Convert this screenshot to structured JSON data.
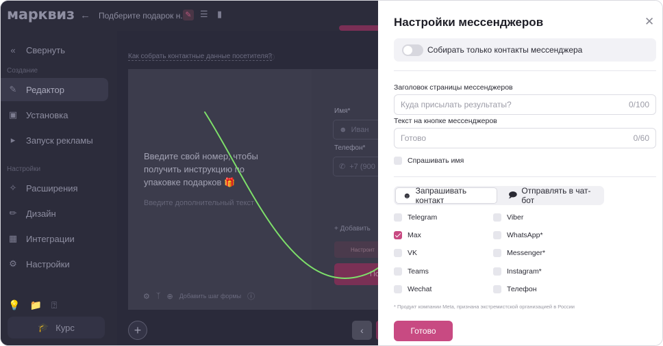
{
  "app": {
    "logo": "марквиз",
    "page_name": "Подберите подарок н...",
    "sidebar": {
      "collapse": "Свернуть",
      "section_create": "Создание",
      "section_settings": "Настройки",
      "items": [
        {
          "label": "Редактор",
          "icon": "pencil-icon",
          "active": true
        },
        {
          "label": "Установка",
          "icon": "install-icon"
        },
        {
          "label": "Запуск рекламы",
          "icon": "megaphone-icon"
        },
        {
          "label": "Расширения",
          "icon": "puzzle-icon"
        },
        {
          "label": "Дизайн",
          "icon": "brush-icon"
        },
        {
          "label": "Интеграции",
          "icon": "integrations-icon"
        },
        {
          "label": "Настройки",
          "icon": "gear-icon"
        }
      ],
      "course": "Курс"
    },
    "main": {
      "help_link": "Как собрать контактные данные посетителя?",
      "form_title": "Введите свой номер, чтобы получить инструкцию по упаковке подарков 🎁",
      "form_subtitle": "Введите дополнительный текст",
      "name_label": "Имя*",
      "name_placeholder": "Иван",
      "phone_label": "Телефон*",
      "phone_placeholder": "+7 (900",
      "add_field": "+ Добавить",
      "settings_btn": "Настроит",
      "submit_btn": "По",
      "add_step": "Добавить шаг формы"
    }
  },
  "panel": {
    "title": "Настройки мессенджеров",
    "toggle_label": "Собирать только контакты мессенджера",
    "toggle_on": false,
    "header_label": "Заголовок страницы мессенджеров",
    "header_placeholder": "Куда присылать результаты?",
    "header_counter": "0/100",
    "button_label": "Текст на кнопке мессенджеров",
    "button_placeholder": "Готово",
    "button_counter": "0/60",
    "ask_name": "Спрашивать имя",
    "tabs": [
      "Запрашивать контакт",
      "Отправлять в чат-бот"
    ],
    "messengers_left": [
      {
        "name": "Telegram",
        "checked": false
      },
      {
        "name": "Max",
        "checked": true
      },
      {
        "name": "VK",
        "checked": false
      },
      {
        "name": "Teams",
        "checked": false
      },
      {
        "name": "Wechat",
        "checked": false
      }
    ],
    "messengers_right": [
      {
        "name": "Viber",
        "checked": false
      },
      {
        "name": "WhatsApp*",
        "checked": false
      },
      {
        "name": "Messenger*",
        "checked": false
      },
      {
        "name": "Instagram*",
        "checked": false
      },
      {
        "name": "Телефон",
        "checked": false
      }
    ],
    "note": "* Продукт компании Meta, признана экстремистской организацией в России",
    "done": "Готово",
    "accent_color": "#c84a82"
  }
}
